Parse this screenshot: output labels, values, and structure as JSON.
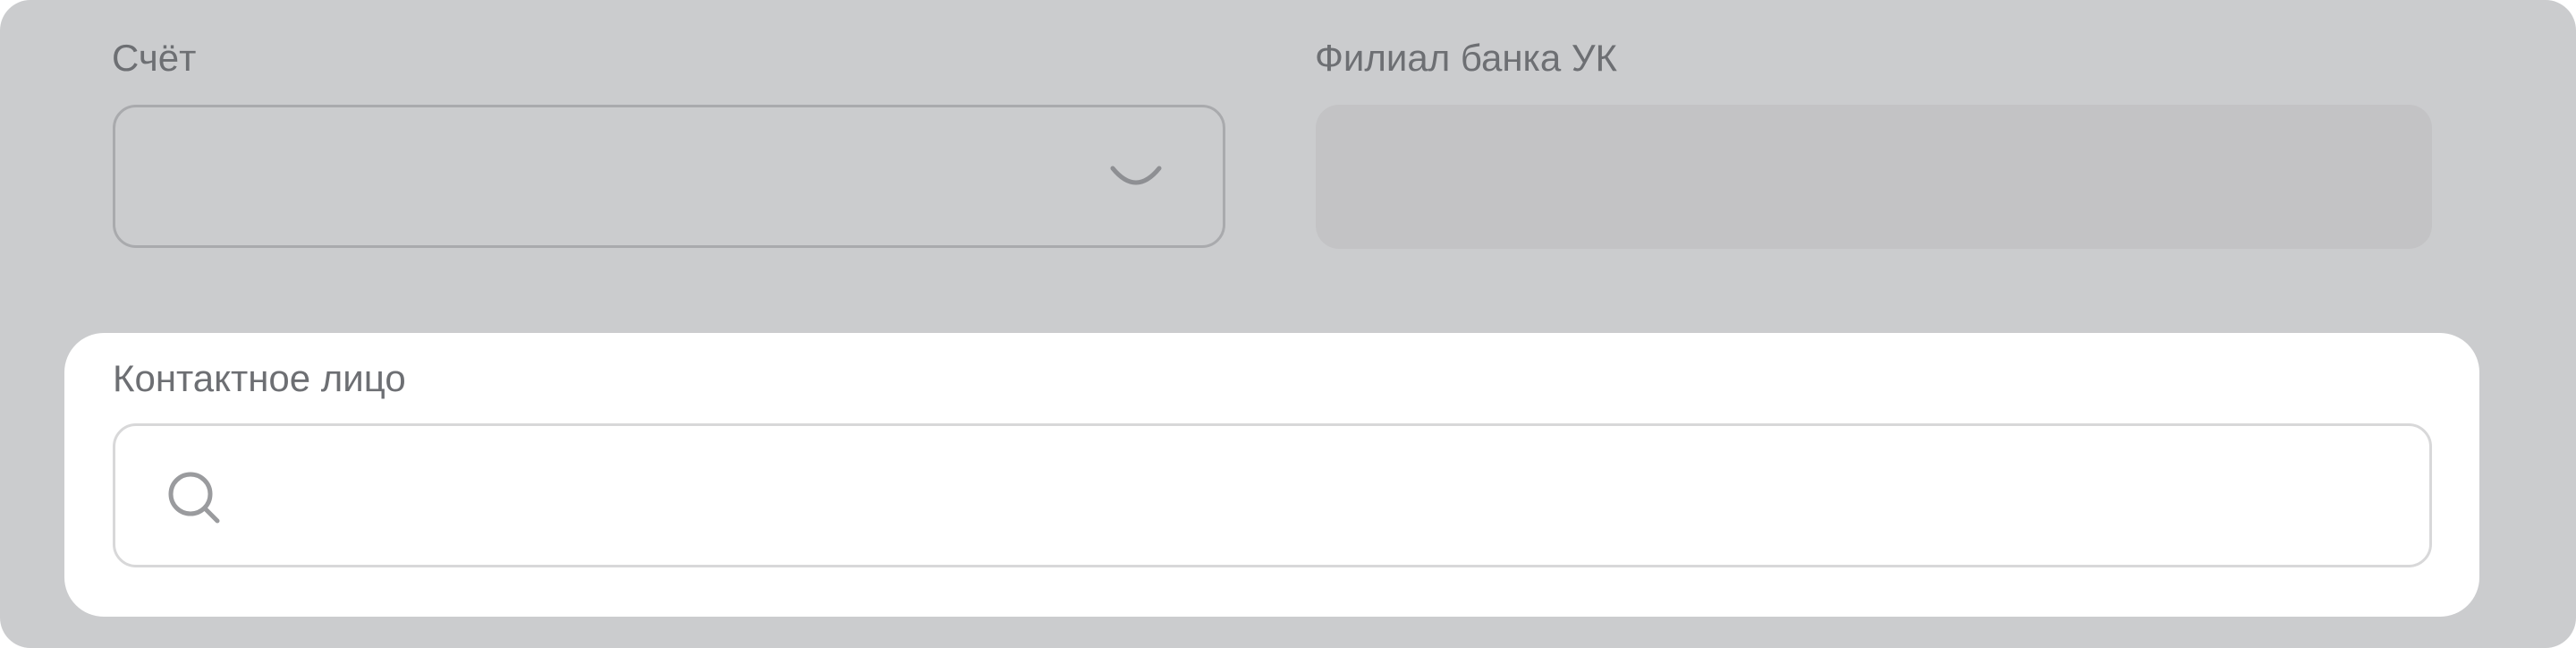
{
  "account_field": {
    "label": "Счёт",
    "value": "",
    "icon": "chevron-down-icon"
  },
  "branch_field": {
    "label": "Филиал банка УК",
    "value": ""
  },
  "contact_field": {
    "label": "Контактное лицо",
    "value": "",
    "icon": "search-icon"
  },
  "colors": {
    "overlay": "#cbccce",
    "card": "#ffffff",
    "label_text": "#6d6f73",
    "disabled_field": "#c3c3c5",
    "icon": "#8e8f93"
  }
}
